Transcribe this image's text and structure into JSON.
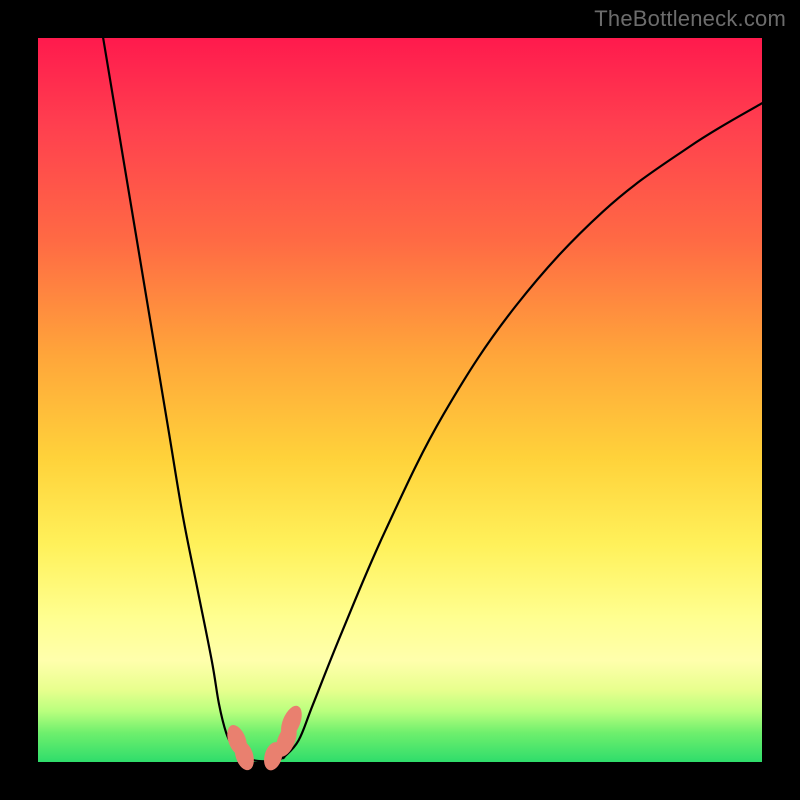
{
  "watermark": "TheBottleneck.com",
  "colors": {
    "frame": "#000000",
    "gradient_top": "#ff1a4d",
    "gradient_bottom": "#2fdd6b",
    "curve": "#000000",
    "marker": "#e9806f"
  },
  "chart_data": {
    "type": "line",
    "title": "",
    "xlabel": "",
    "ylabel": "",
    "xlim": [
      0,
      100
    ],
    "ylim": [
      0,
      100
    ],
    "grid": false,
    "legend": false,
    "note": "No axis ticks or numeric labels are present in the image; values below are estimated pixel-normalized coordinates (0–100) read directly from the curve geometry.",
    "series": [
      {
        "name": "left-branch",
        "x": [
          9,
          12,
          15,
          18,
          20,
          22,
          24,
          25,
          26,
          27,
          28,
          29
        ],
        "y": [
          100,
          82,
          64,
          46,
          34,
          24,
          14,
          8,
          4,
          2,
          1,
          0.5
        ]
      },
      {
        "name": "valley",
        "x": [
          29,
          30,
          31,
          32,
          33,
          34
        ],
        "y": [
          0.5,
          0.2,
          0.1,
          0.1,
          0.2,
          0.7
        ]
      },
      {
        "name": "right-branch",
        "x": [
          34,
          36,
          38,
          42,
          48,
          56,
          66,
          78,
          90,
          100
        ],
        "y": [
          0.7,
          3,
          8,
          18,
          32,
          48,
          63,
          76,
          85,
          91
        ]
      }
    ],
    "markers": [
      {
        "x": 27.5,
        "y": 3.0,
        "rx": 1.2,
        "ry": 2.2,
        "rot": -20
      },
      {
        "x": 28.5,
        "y": 0.9,
        "rx": 1.2,
        "ry": 2.1,
        "rot": -18
      },
      {
        "x": 32.5,
        "y": 0.8,
        "rx": 1.2,
        "ry": 2.0,
        "rot": 16
      },
      {
        "x": 34.3,
        "y": 3.0,
        "rx": 1.2,
        "ry": 2.4,
        "rot": 22
      },
      {
        "x": 35.0,
        "y": 5.5,
        "rx": 1.2,
        "ry": 2.4,
        "rot": 22
      }
    ]
  }
}
